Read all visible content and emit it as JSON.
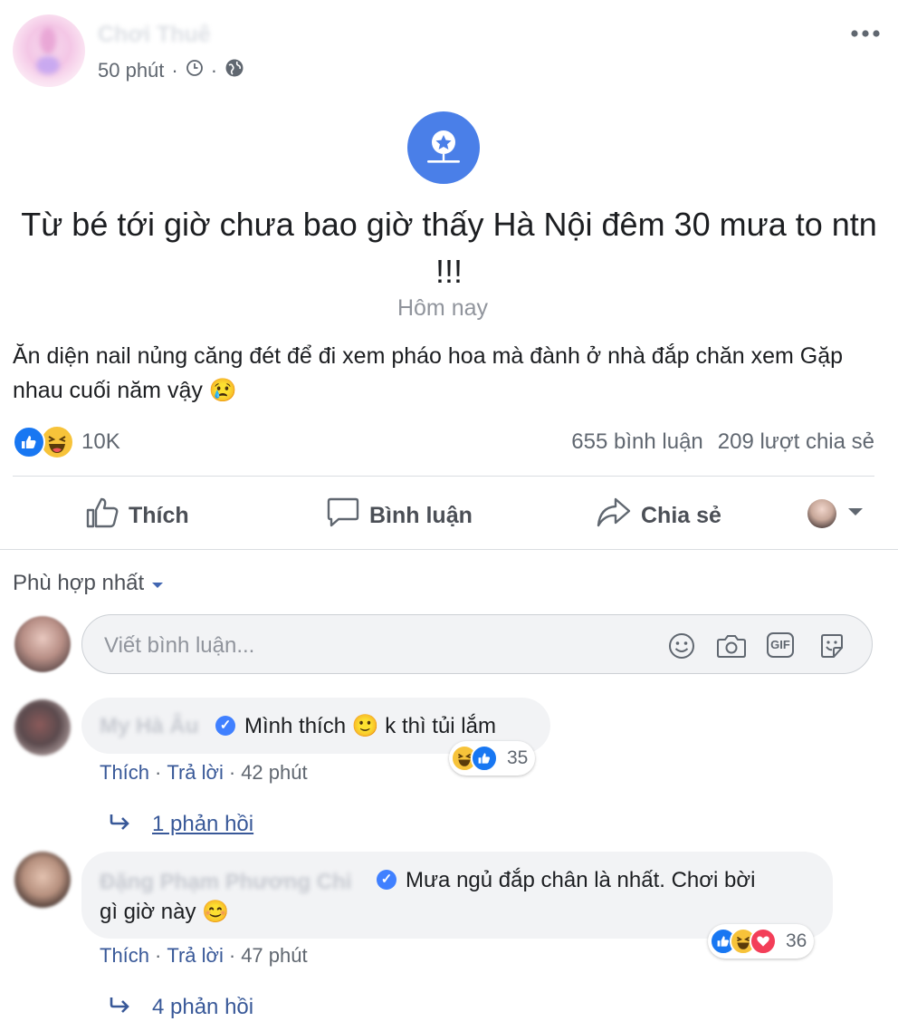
{
  "post": {
    "author": "Chơi Thuê",
    "time": "50 phút",
    "separator": "·",
    "event_title": "Từ bé tới giờ chưa bao giờ thấy Hà Nội đêm 30 mưa to ntn !!!",
    "event_date": "Hôm nay",
    "text": "Ăn diện nail nủng căng đét để đi xem pháo hoa mà đành ở nhà đắp chăn xem Gặp nhau cuối năm vậy 😢",
    "reaction_count": "10K",
    "comments_count": "655 bình luận",
    "shares_count": "209 lượt chia sẻ"
  },
  "actions": {
    "like": "Thích",
    "comment": "Bình luận",
    "share": "Chia sẻ"
  },
  "comments_section": {
    "sort_label": "Phù hợp nhất",
    "input_placeholder": "Viết bình luận...",
    "gif_label": "GIF"
  },
  "comments": [
    {
      "author": "My Hà Âu",
      "text": "Mình thích 🙂 k thì tủi lắm",
      "reactions": "35",
      "like": "Thích",
      "reply": "Trả lời",
      "time": "42 phút",
      "replies": "1 phản hồi"
    },
    {
      "author": "Đặng Phạm Phương Chi",
      "text_line1": "Mưa ngủ đắp chân là nhất. Chơi bời",
      "text_line2": "gì giờ này 😊",
      "reactions": "36",
      "like": "Thích",
      "reply": "Trả lời",
      "time": "47 phút",
      "replies": "4 phản hồi"
    }
  ],
  "colors": {
    "accent": "#4267b2",
    "event_icon": "#4a7fe8",
    "link": "#385898",
    "muted": "#606770",
    "bubble": "#f2f3f5",
    "like": "#1877f2",
    "love": "#f33e58",
    "haha": "#f7c33a"
  }
}
